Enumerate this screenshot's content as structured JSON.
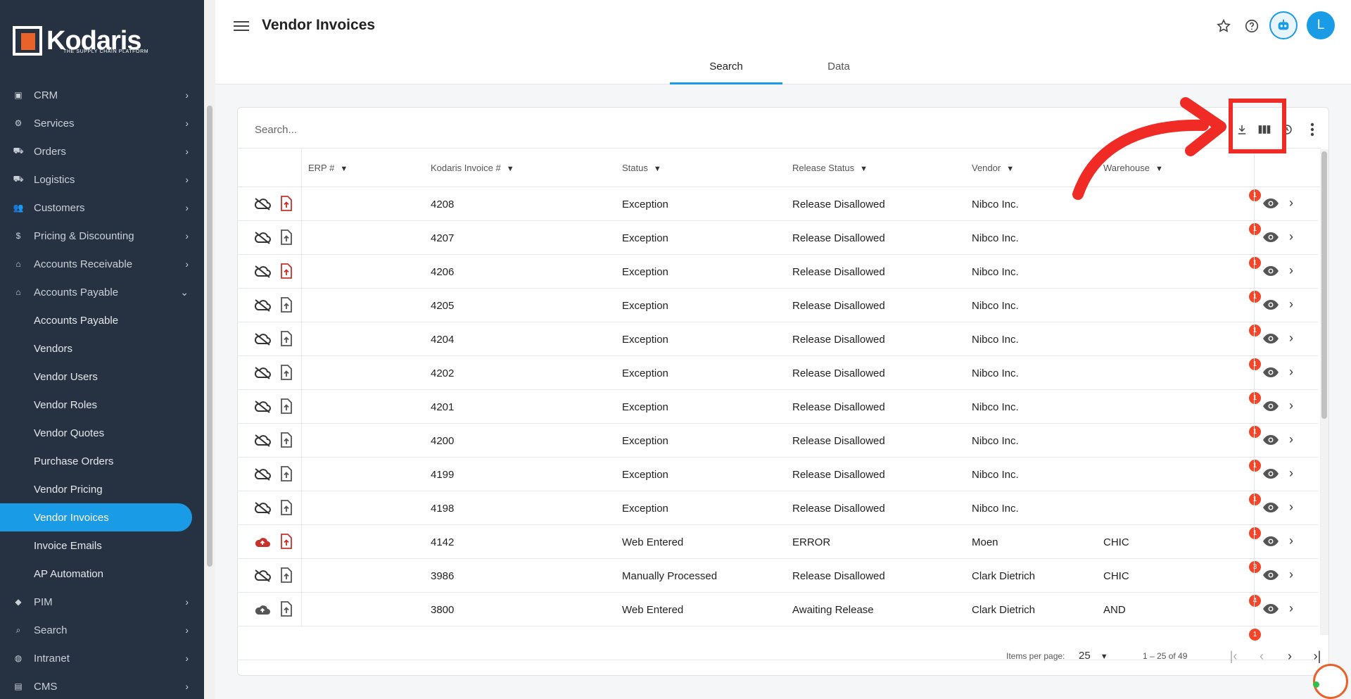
{
  "app": {
    "logo_text": "Kodaris",
    "logo_tagline": "THE SUPPLY CHAIN PLATFORM",
    "user_initial": "L"
  },
  "sidebar": {
    "items": [
      {
        "label": "CRM",
        "icon": "crm-icon"
      },
      {
        "label": "Services",
        "icon": "services-icon"
      },
      {
        "label": "Orders",
        "icon": "truck-icon"
      },
      {
        "label": "Logistics",
        "icon": "logistics-icon"
      },
      {
        "label": "Customers",
        "icon": "people-icon"
      },
      {
        "label": "Pricing & Discounting",
        "icon": "dollar-icon"
      },
      {
        "label": "Accounts Receivable",
        "icon": "bank-icon"
      },
      {
        "label": "Accounts Payable",
        "icon": "bank-icon"
      }
    ],
    "sub_items": [
      "Accounts Payable",
      "Vendors",
      "Vendor Users",
      "Vendor Roles",
      "Vendor Quotes",
      "Purchase Orders",
      "Vendor Pricing",
      "Vendor Invoices",
      "Invoice Emails",
      "AP Automation"
    ],
    "active_sub": "Vendor Invoices",
    "bottom_items": [
      {
        "label": "PIM",
        "icon": "tag-icon"
      },
      {
        "label": "Search",
        "icon": "search-icon"
      },
      {
        "label": "Intranet",
        "icon": "globe-icon"
      },
      {
        "label": "CMS",
        "icon": "cms-icon"
      }
    ]
  },
  "header": {
    "title": "Vendor Invoices",
    "tabs": [
      "Search",
      "Data"
    ],
    "active_tab": "Search"
  },
  "search": {
    "placeholder": "Search..."
  },
  "table": {
    "columns": [
      "ERP #",
      "Kodaris Invoice #",
      "Status",
      "Release Status",
      "Vendor",
      "Warehouse"
    ],
    "rows": [
      {
        "invoice": "4208",
        "status": "Exception",
        "release": "Release Disallowed",
        "vendor": "Nibco Inc.",
        "warehouse": "",
        "badge": "1",
        "cloud": "off",
        "doc": "red"
      },
      {
        "invoice": "4207",
        "status": "Exception",
        "release": "Release Disallowed",
        "vendor": "Nibco Inc.",
        "warehouse": "",
        "badge": "1",
        "cloud": "off",
        "doc": "gray"
      },
      {
        "invoice": "4206",
        "status": "Exception",
        "release": "Release Disallowed",
        "vendor": "Nibco Inc.",
        "warehouse": "",
        "badge": "1",
        "cloud": "off",
        "doc": "red"
      },
      {
        "invoice": "4205",
        "status": "Exception",
        "release": "Release Disallowed",
        "vendor": "Nibco Inc.",
        "warehouse": "",
        "badge": "1",
        "cloud": "off",
        "doc": "gray"
      },
      {
        "invoice": "4204",
        "status": "Exception",
        "release": "Release Disallowed",
        "vendor": "Nibco Inc.",
        "warehouse": "",
        "badge": "1",
        "cloud": "off",
        "doc": "gray"
      },
      {
        "invoice": "4202",
        "status": "Exception",
        "release": "Release Disallowed",
        "vendor": "Nibco Inc.",
        "warehouse": "",
        "badge": "1",
        "cloud": "off",
        "doc": "gray"
      },
      {
        "invoice": "4201",
        "status": "Exception",
        "release": "Release Disallowed",
        "vendor": "Nibco Inc.",
        "warehouse": "",
        "badge": "1",
        "cloud": "off",
        "doc": "gray"
      },
      {
        "invoice": "4200",
        "status": "Exception",
        "release": "Release Disallowed",
        "vendor": "Nibco Inc.",
        "warehouse": "",
        "badge": "1",
        "cloud": "off",
        "doc": "gray"
      },
      {
        "invoice": "4199",
        "status": "Exception",
        "release": "Release Disallowed",
        "vendor": "Nibco Inc.",
        "warehouse": "",
        "badge": "1",
        "cloud": "off",
        "doc": "gray"
      },
      {
        "invoice": "4198",
        "status": "Exception",
        "release": "Release Disallowed",
        "vendor": "Nibco Inc.",
        "warehouse": "",
        "badge": "1",
        "cloud": "off",
        "doc": "gray"
      },
      {
        "invoice": "4142",
        "status": "Web Entered",
        "release": "ERROR",
        "vendor": "Moen",
        "warehouse": "CHIC",
        "badge": "1",
        "cloud": "red",
        "doc": "red"
      },
      {
        "invoice": "3986",
        "status": "Manually Processed",
        "release": "Release Disallowed",
        "vendor": "Clark Dietrich",
        "warehouse": "CHIC",
        "badge": "3",
        "cloud": "off",
        "doc": "gray"
      },
      {
        "invoice": "3800",
        "status": "Web Entered",
        "release": "Awaiting Release",
        "vendor": "Clark Dietrich",
        "warehouse": "AND",
        "badge": "4",
        "cloud": "gray",
        "doc": "gray"
      },
      {
        "invoice": "",
        "status": "",
        "release": "",
        "vendor": "",
        "warehouse": "",
        "badge": "1",
        "cloud": "none",
        "doc": "none"
      }
    ]
  },
  "pagination": {
    "items_per_page_label": "Items per page:",
    "items_per_page": "25",
    "range": "1 – 25 of 49"
  },
  "colors": {
    "accent": "#1a9be6",
    "sidebar_bg": "#263241",
    "badge": "#f2452a",
    "annotation": "#f02a24",
    "brand_orange": "#e8622a"
  }
}
